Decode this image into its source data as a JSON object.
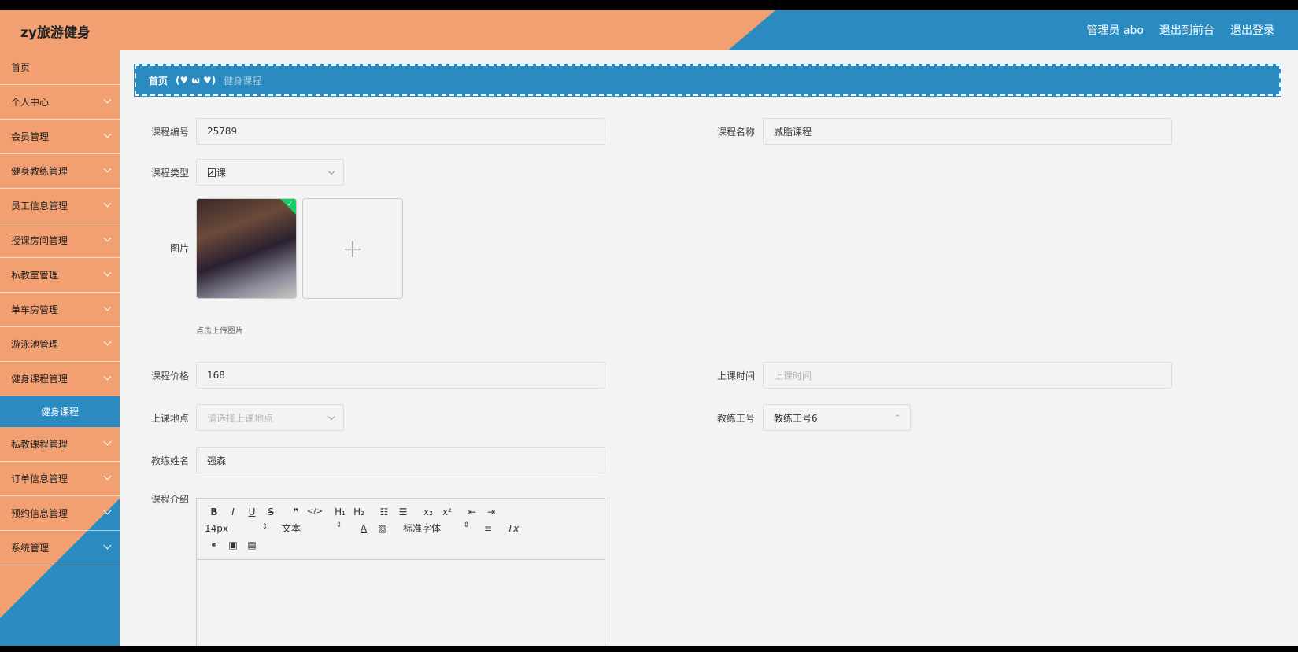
{
  "header": {
    "brand": "zy旅游健身",
    "admin": "管理员 abo",
    "to_front": "退出到前台",
    "logout": "退出登录"
  },
  "sidebar": {
    "items": [
      {
        "label": "首页"
      },
      {
        "label": "个人中心"
      },
      {
        "label": "会员管理"
      },
      {
        "label": "健身教练管理"
      },
      {
        "label": "员工信息管理"
      },
      {
        "label": "授课房间管理"
      },
      {
        "label": "私教室管理"
      },
      {
        "label": "单车房管理"
      },
      {
        "label": "游泳池管理"
      },
      {
        "label": "健身课程管理"
      },
      {
        "label": "健身课程"
      },
      {
        "label": "私教课程管理"
      },
      {
        "label": "订单信息管理"
      },
      {
        "label": "预约信息管理"
      },
      {
        "label": "系统管理"
      }
    ]
  },
  "breadcrumb": {
    "home": "首页",
    "separator": "(♥ ω ♥)",
    "current": "健身课程"
  },
  "form": {
    "course_no_label": "课程编号",
    "course_no_value": "25789",
    "course_name_label": "课程名称",
    "course_name_value": "减脂课程",
    "course_type_label": "课程类型",
    "course_type_value": "团课",
    "image_label": "图片",
    "upload_tip": "点击上传图片",
    "price_label": "课程价格",
    "price_value": "168",
    "time_label": "上课时间",
    "time_placeholder": "上课时间",
    "place_label": "上课地点",
    "place_placeholder": "请选择上课地点",
    "coach_no_label": "教练工号",
    "coach_no_value": "教练工号6",
    "coach_name_label": "教练姓名",
    "coach_name_value": "强森",
    "intro_label": "课程介绍"
  },
  "editor": {
    "font_size": "14px",
    "text_style": "文本",
    "font_family": "标准字体"
  },
  "colors": {
    "orange": "#f2a072",
    "blue": "#2b8bc0",
    "background": "#f3f3f3"
  }
}
